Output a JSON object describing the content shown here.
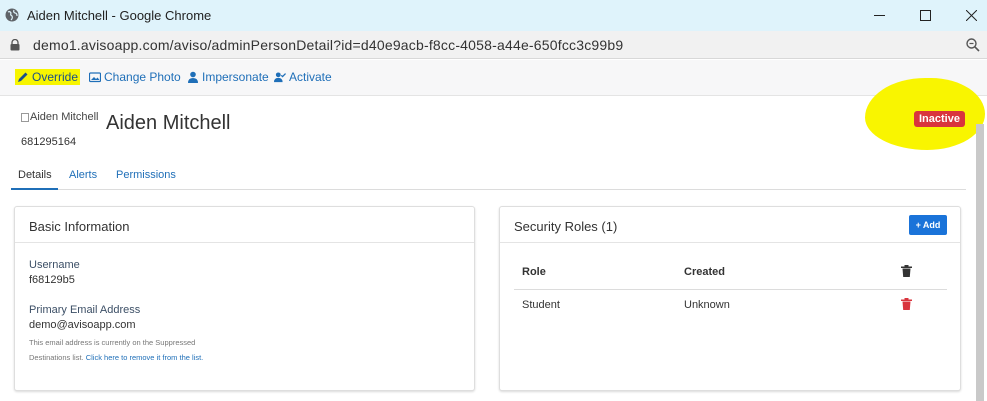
{
  "window": {
    "title": "Aiden Mitchell - Google Chrome",
    "url": "demo1.avisoapp.com/aviso/adminPersonDetail?id=d40e9acb-f8cc-4058-a44e-650fcc3c99b9"
  },
  "toolbar": {
    "override": "Override",
    "change_photo": "Change Photo",
    "impersonate": "Impersonate",
    "activate": "Activate"
  },
  "person": {
    "photo_alt": "Aiden Mitchell",
    "name": "Aiden Mitchell",
    "id": "681295164",
    "status": "Inactive"
  },
  "tabs": [
    {
      "label": "Details"
    },
    {
      "label": "Alerts"
    },
    {
      "label": "Permissions"
    }
  ],
  "basic_info": {
    "title": "Basic Information",
    "username_label": "Username",
    "username": "f68129b5",
    "email_label": "Primary Email Address",
    "email": "demo@avisoapp.com",
    "suppressed_note_1": "This email address is currently on the Suppressed",
    "suppressed_note_2": "Destinations list.",
    "suppressed_link": "Click here to remove it from the list."
  },
  "security_roles": {
    "title": "Security Roles (1)",
    "add_label": "Add",
    "columns": [
      "Role",
      "Created"
    ],
    "rows": [
      {
        "role": "Student",
        "created": "Unknown"
      }
    ]
  },
  "colors": {
    "accent": "#1f6fb8",
    "highlight": "#f9f500",
    "danger": "#d9343d",
    "add_button": "#1a73d9"
  }
}
